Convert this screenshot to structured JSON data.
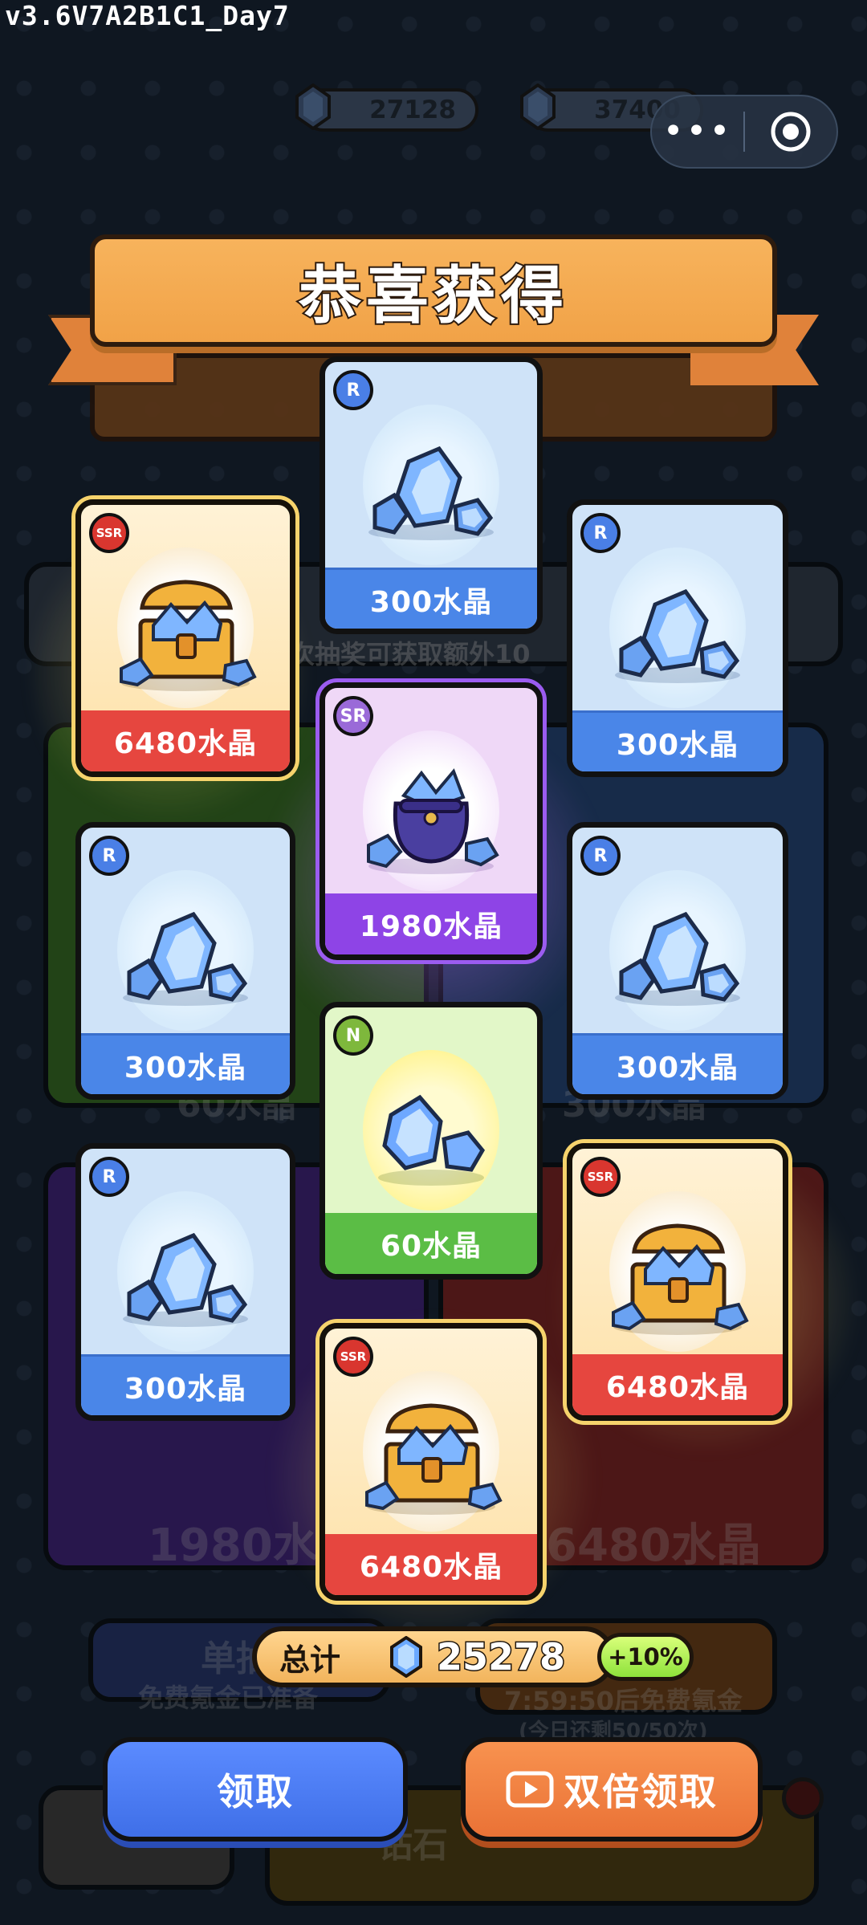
{
  "version": "v3.6V7A2B1C1_Day7",
  "currency": {
    "crystals": "27128",
    "diamonds": "37400"
  },
  "capsule": {
    "menu": "•••"
  },
  "title": "恭喜获得",
  "cards": [
    {
      "rarity": "R",
      "label": "300水晶",
      "kind": "crystal"
    },
    {
      "rarity": "SSR",
      "label": "6480水晶",
      "kind": "chest"
    },
    {
      "rarity": "R",
      "label": "300水晶",
      "kind": "crystal"
    },
    {
      "rarity": "SR",
      "label": "1980水晶",
      "kind": "bag"
    },
    {
      "rarity": "R",
      "label": "300水晶",
      "kind": "crystal"
    },
    {
      "rarity": "R",
      "label": "300水晶",
      "kind": "crystal"
    },
    {
      "rarity": "N",
      "label": "60水晶",
      "kind": "small"
    },
    {
      "rarity": "R",
      "label": "300水晶",
      "kind": "crystal"
    },
    {
      "rarity": "SSR",
      "label": "6480水晶",
      "kind": "chest"
    },
    {
      "rarity": "SSR",
      "label": "6480水晶",
      "kind": "chest"
    }
  ],
  "background": {
    "hint": "次抽奖可获取额外10",
    "panel_left": "1980水晶",
    "panel_right": "6480水晶",
    "mid_left": "60水晶",
    "mid_right": "300水晶",
    "single_title": "单抽",
    "single_sub": "免费氪金已准备",
    "multi_sub": "7:59:50后免费氪金",
    "multi_sub2": "(今日还剩50/50次)",
    "diamond_btn": "钻石"
  },
  "total": {
    "label": "总计",
    "value": "25278",
    "bonus": "+10%"
  },
  "buttons": {
    "claim": "领取",
    "double_claim": "双倍领取"
  },
  "colors": {
    "background": "#1c2a3c",
    "r_label": "#4a86e8",
    "ssr_label": "#e6463f",
    "sr_label": "#8e44e6",
    "n_label": "#5bbd45",
    "claim_button": "#4a7cf3",
    "double_button": "#f07f40"
  }
}
